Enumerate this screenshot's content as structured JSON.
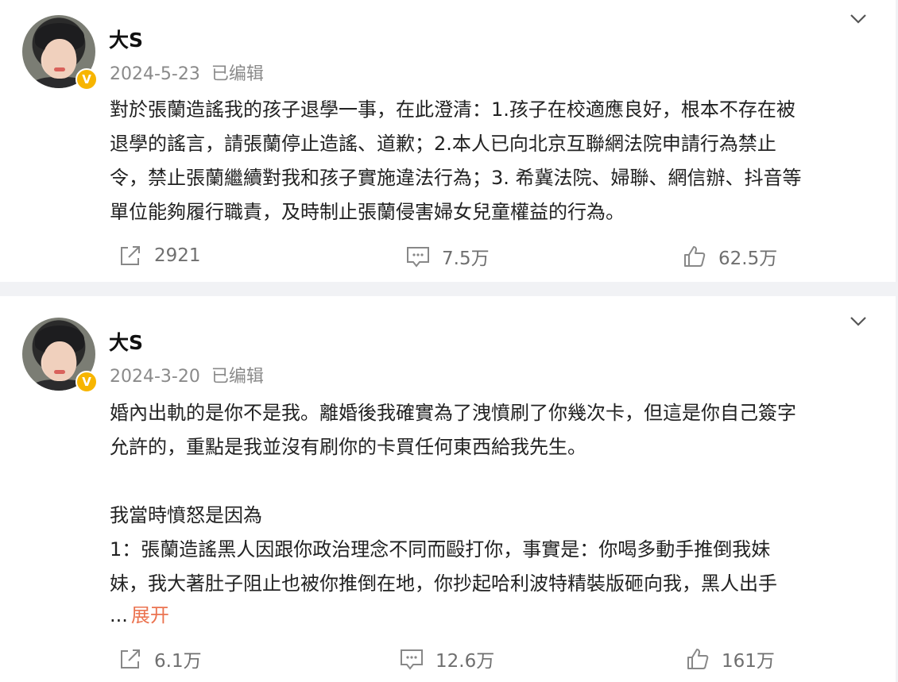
{
  "posts": [
    {
      "author": "大S",
      "date": "2024-5-23",
      "edited": "已编辑",
      "verified_badge": "V",
      "content": "對於張蘭造謠我的孩子退學一事，在此澄清：1.孩子在校適應良好，根本不存在被\n退學的謠言，請張蘭停止造謠、道歉；2.本人已向北京互聯網法院申請行為禁止\n令，禁止張蘭繼續對我和孩子實施違法行為；3. 希冀法院、婦聯、網信辦、抖音等\n單位能夠履行職責，及時制止張蘭侵害婦女兒童權益的行為。",
      "shares": "2921",
      "comments": "7.5万",
      "likes": "62.5万"
    },
    {
      "author": "大S",
      "date": "2024-3-20",
      "edited": "已编辑",
      "verified_badge": "V",
      "content": "婚內出軌的是你不是我。離婚後我確實為了洩憤刷了你幾次卡，但這是你自己簽字\n允許的，重點是我並沒有刷你的卡買任何東西給我先生。\n\n我當時憤怒是因為\n1：張蘭造謠黑人因跟你政治理念不同而毆打你，事實是：你喝多動手推倒我妹\n妹，我大著肚子阻止也被你推倒在地，你抄起哈利波特精裝版砸向我，黑人出手",
      "ellipsis": "...",
      "expand_label": "展开",
      "shares": "6.1万",
      "comments": "12.6万",
      "likes": "161万"
    }
  ],
  "icons": [
    "chevron-down-icon",
    "share-icon",
    "comment-icon",
    "like-icon",
    "verified-icon"
  ],
  "colors": {
    "expand_link": "#eb7350",
    "badge": "#f7b500",
    "muted": "#8a8a8a",
    "background": "#f1f2f5"
  }
}
